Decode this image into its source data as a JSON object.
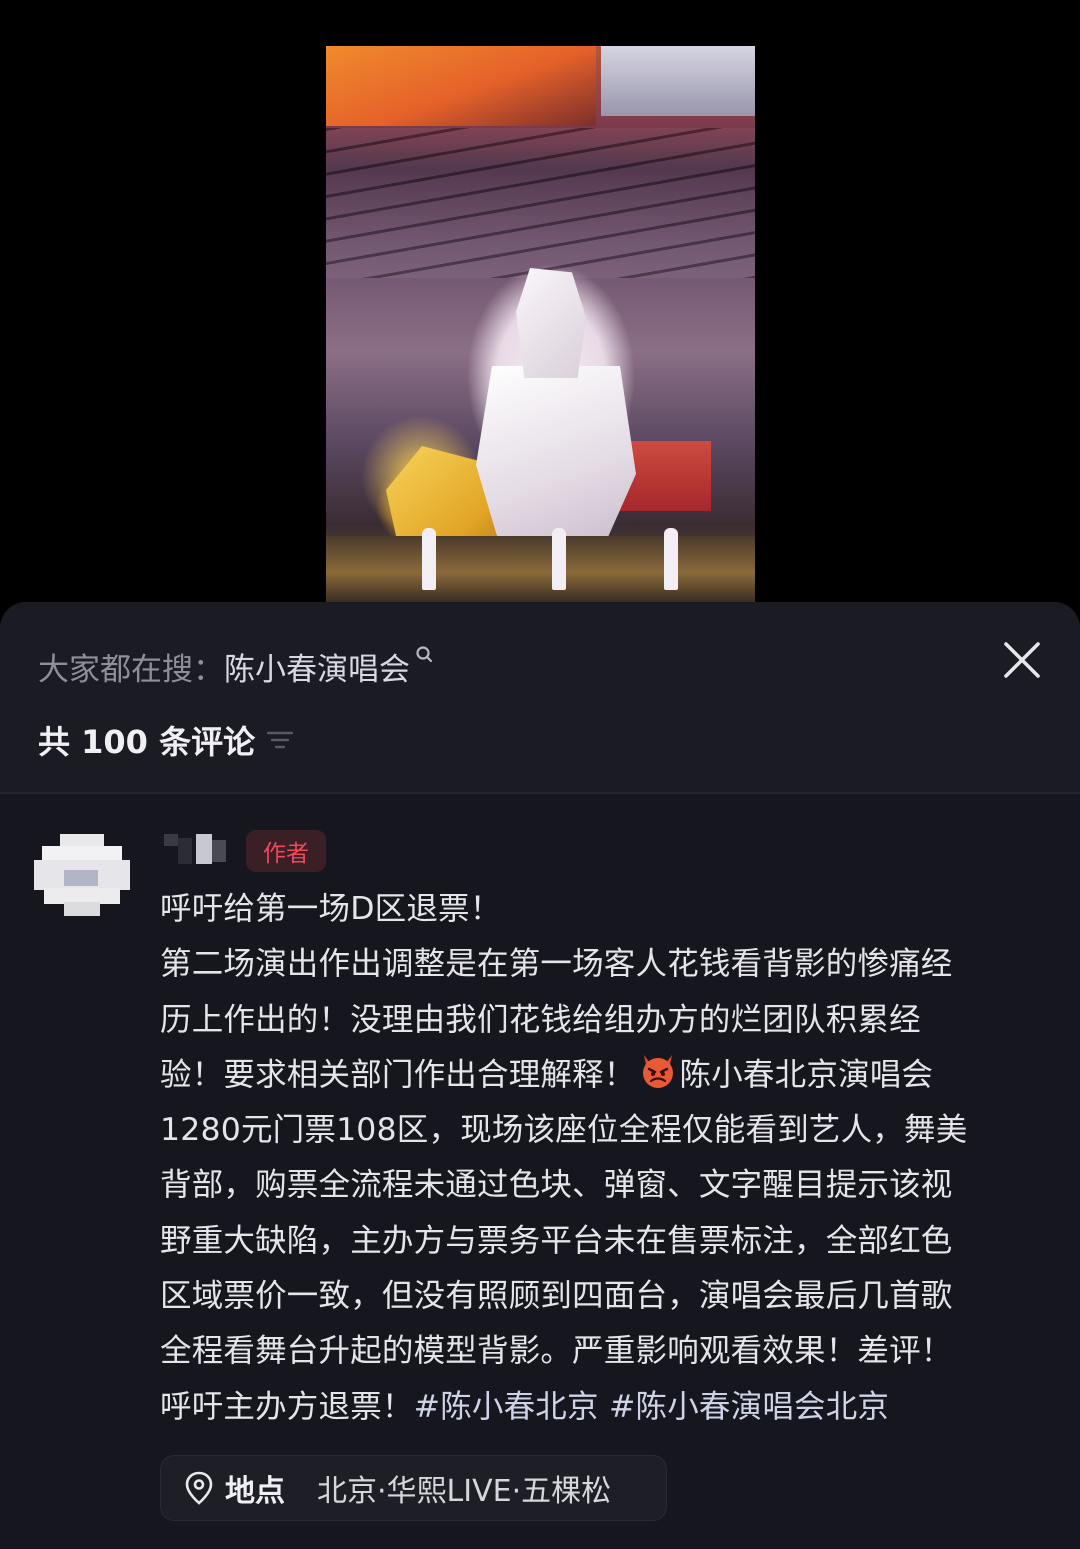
{
  "hot_search": {
    "prefix": "大家都在搜：",
    "term": "陈小春演唱会"
  },
  "comments_count_label": "共 100 条评论",
  "comment": {
    "author_badge": "作者",
    "lines": [
      "呼吁给第一场D区退票！",
      "第二场演出作出调整是在第一场客人花钱看背影的惨痛经",
      "历上作出的！没理由我们花钱给组办方的烂团队积累经",
      "验！要求相关部门作出合理解释！",
      "陈小春北京演唱会",
      "1280元门票108区，现场该座位全程仅能看到艺人，舞美",
      "背部，购票全流程未通过色块、弹窗、文字醒目提示该视",
      "野重大缺陷，主办方与票务平台未在售票标注，全部红色",
      "区域票价一致，但没有照顾到四面台，演唱会最后几首歌",
      "全程看舞台升起的模型背影。严重影响观看效果！差评！",
      "呼吁主办方退票！",
      "#陈小春北京",
      "#陈小春演唱会北京"
    ],
    "emoji_icon": "angry-devil-emoji"
  },
  "location": {
    "icon": "location-pin-icon",
    "label": "地点",
    "place": "北京·华熙LIVE·五棵松"
  },
  "colors": {
    "background": "#000000",
    "sheet": "#16161e",
    "author_badge_text": "#f04a5a",
    "author_badge_bg": "#3a1f27"
  }
}
